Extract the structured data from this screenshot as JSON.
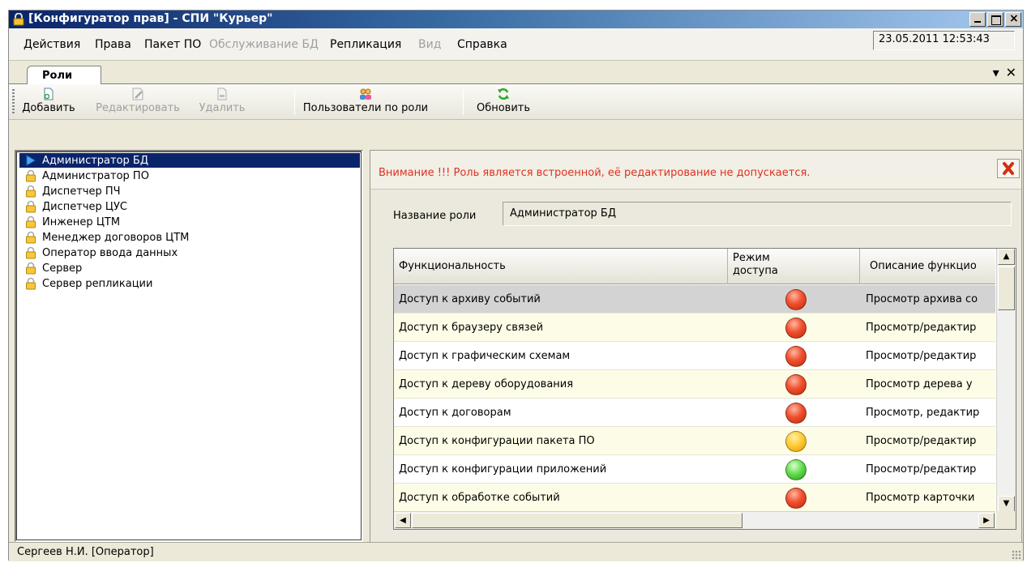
{
  "window": {
    "title": "[Конфигуратор прав] - СПИ \"Курьер\"",
    "datetime": "23.05.2011 12:53:43"
  },
  "menu": [
    {
      "label": "Действия",
      "enabled": true
    },
    {
      "label": "Права",
      "enabled": true
    },
    {
      "label": "Пакет ПО",
      "enabled": true
    },
    {
      "label": "Обслуживание БД",
      "enabled": false
    },
    {
      "label": "Репликация",
      "enabled": true
    },
    {
      "label": "Вид",
      "enabled": false
    },
    {
      "label": "Справка",
      "enabled": true
    }
  ],
  "tab": {
    "label": "Роли",
    "controls": [
      "▾",
      "✕"
    ]
  },
  "toolbar": {
    "add": "Добавить",
    "edit": "Редактировать",
    "delete": "Удалить",
    "users_by_role": "Пользователи по роли",
    "refresh": "Обновить"
  },
  "roles": [
    {
      "label": "Администратор БД",
      "selected": true,
      "icon": "arrow-icon"
    },
    {
      "label": "Администратор ПО",
      "icon": "lock-icon"
    },
    {
      "label": "Диспетчер ПЧ",
      "icon": "lock-icon"
    },
    {
      "label": "Диспетчер ЦУС",
      "icon": "lock-icon"
    },
    {
      "label": "Инженер ЦТМ",
      "icon": "lock-icon"
    },
    {
      "label": "Менеджер договоров ЦТМ",
      "icon": "lock-icon"
    },
    {
      "label": "Оператор ввода данных",
      "icon": "lock-icon"
    },
    {
      "label": "Сервер",
      "icon": "lock-icon"
    },
    {
      "label": "Сервер репликации",
      "icon": "lock-icon"
    }
  ],
  "warning": "Внимание !!! Роль является встроенной, её редактирование не допускается.",
  "role_name_label": "Название роли",
  "role_name_value": "Администратор БД",
  "grid": {
    "columns": [
      "Функциональность",
      "Режим доступа",
      "Описание функцио"
    ],
    "rows": [
      {
        "name": "Доступ к архиву событий",
        "mode": "red",
        "desc": "Просмотр архива со"
      },
      {
        "name": "Доступ к браузеру связей",
        "mode": "red",
        "desc": "Просмотр/редактир"
      },
      {
        "name": "Доступ к графическим схемам",
        "mode": "red",
        "desc": "Просмотр/редактир"
      },
      {
        "name": "Доступ к дереву оборудования",
        "mode": "red",
        "desc": "Просмотр дерева у"
      },
      {
        "name": "Доступ к договорам",
        "mode": "red",
        "desc": "Просмотр, редактир"
      },
      {
        "name": "Доступ к конфигурации пакета ПО",
        "mode": "yellow",
        "desc": "Просмотр/редактир"
      },
      {
        "name": "Доступ к конфигурации приложений",
        "mode": "green",
        "desc": "Просмотр/редактир"
      },
      {
        "name": "Доступ к обработке событий",
        "mode": "red",
        "desc": "Просмотр карточки"
      }
    ]
  },
  "status": "Сергеев Н.И. [Оператор]"
}
